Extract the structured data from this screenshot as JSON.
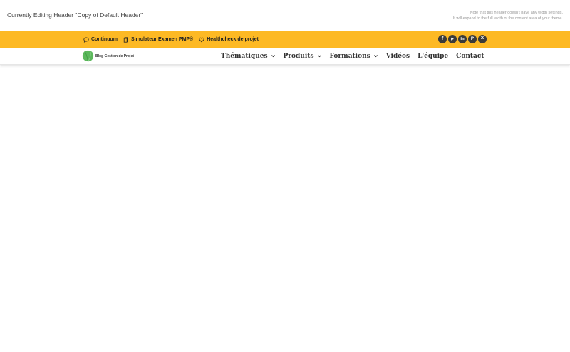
{
  "editor": {
    "title": "Currently Editing Header \"Copy of Default Header\"",
    "note_line1": "Note that this header doesn't have any width settings.",
    "note_line2": "It will expand to the full width of the content area of your theme."
  },
  "topbar": {
    "background": "#fdb924",
    "links": [
      {
        "label": "Continuum",
        "icon": "chat-bubble-icon"
      },
      {
        "label": "Simulateur Examen PMP®",
        "icon": "document-icon"
      },
      {
        "label": "Healthcheck de projet",
        "icon": "heart-icon"
      }
    ],
    "socials": [
      {
        "name": "facebook-icon",
        "glyph": "f"
      },
      {
        "name": "youtube-icon",
        "glyph": "▶"
      },
      {
        "name": "linkedin-icon",
        "glyph": "in"
      },
      {
        "name": "pinterest-icon",
        "glyph": "P"
      },
      {
        "name": "x-icon",
        "glyph": "X"
      }
    ]
  },
  "nav": {
    "logo_text": "Blog Gestion de Projet",
    "logo_color": "#5cb85c",
    "items": [
      {
        "label": "Thématiques",
        "dropdown": true
      },
      {
        "label": "Produits",
        "dropdown": true
      },
      {
        "label": "Formations",
        "dropdown": true
      },
      {
        "label": "Vidéos",
        "dropdown": false
      },
      {
        "label": "L'équipe",
        "dropdown": false
      },
      {
        "label": "Contact",
        "dropdown": false
      }
    ]
  }
}
